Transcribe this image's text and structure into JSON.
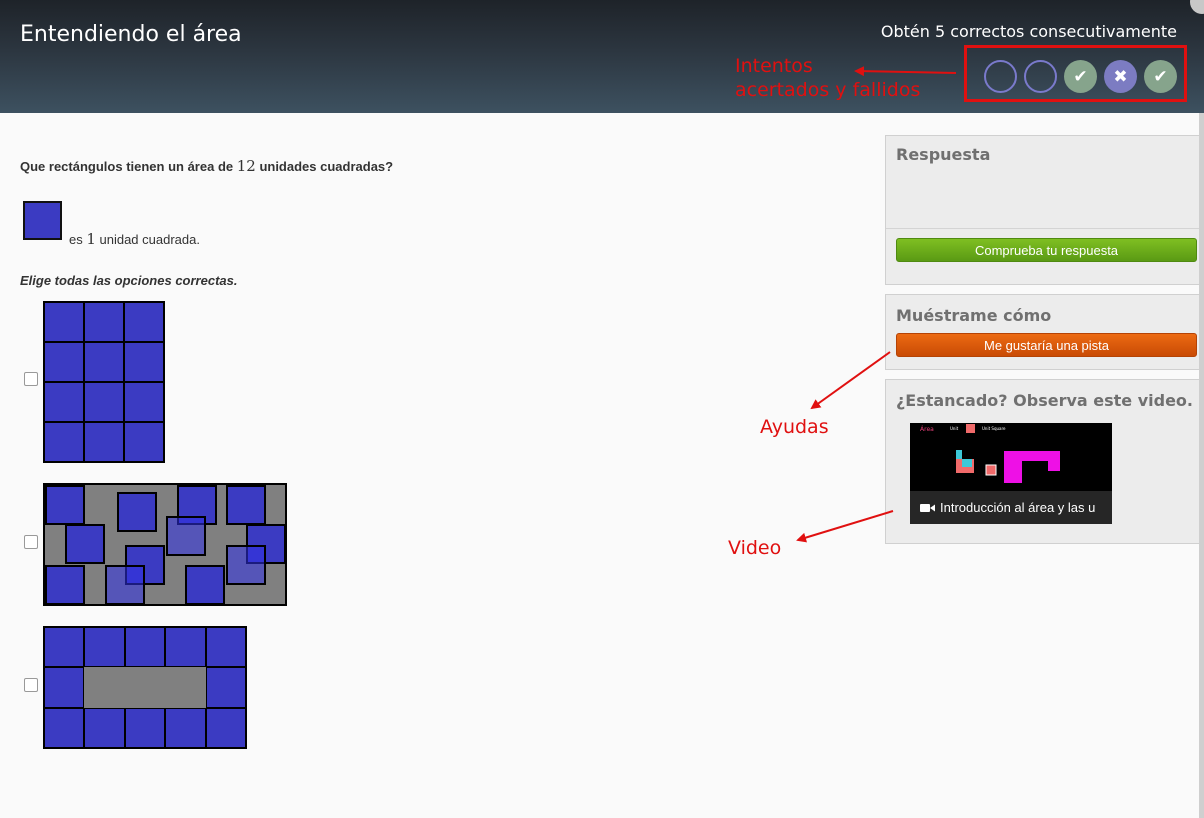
{
  "header": {
    "title": "Entendiendo el área",
    "streak_label": "Obtén 5 correctos consecutivamente",
    "attempts": [
      {
        "status": "empty",
        "symbol": ""
      },
      {
        "status": "empty",
        "symbol": ""
      },
      {
        "status": "correct",
        "symbol": "✔"
      },
      {
        "status": "wrong",
        "symbol": "✖"
      },
      {
        "status": "correct",
        "symbol": "✔"
      }
    ]
  },
  "annotations": {
    "attempts_line1": "Intentos",
    "attempts_line2": "acertados y fallidos",
    "hints": "Ayudas",
    "video": "Video"
  },
  "question": {
    "text_before": "Que rectángulos tienen un área de ",
    "number": "12",
    "text_after": " unidades cuadradas?",
    "unit_prefix": "es ",
    "unit_number": "1",
    "unit_suffix": " unidad cuadrada.",
    "instruction": "Elige todas las opciones correctas."
  },
  "sidebar": {
    "answer_title": "Respuesta",
    "check_button": "Comprueba tu respuesta",
    "hints_title": "Muéstrame cómo",
    "hint_button": "Me gustaría una pista",
    "video_title": "¿Estancado? Observa este video.",
    "video_caption": "Introducción al área y las u",
    "video_thumb_texts": [
      "Área",
      "Unit",
      "Unit Square"
    ]
  },
  "colors": {
    "unit_blue": "#3b3bc2",
    "gray_fill": "#808080",
    "annotation_red": "#e01010",
    "check_green": "#6aab1a",
    "hint_orange": "#dd5a0c"
  }
}
